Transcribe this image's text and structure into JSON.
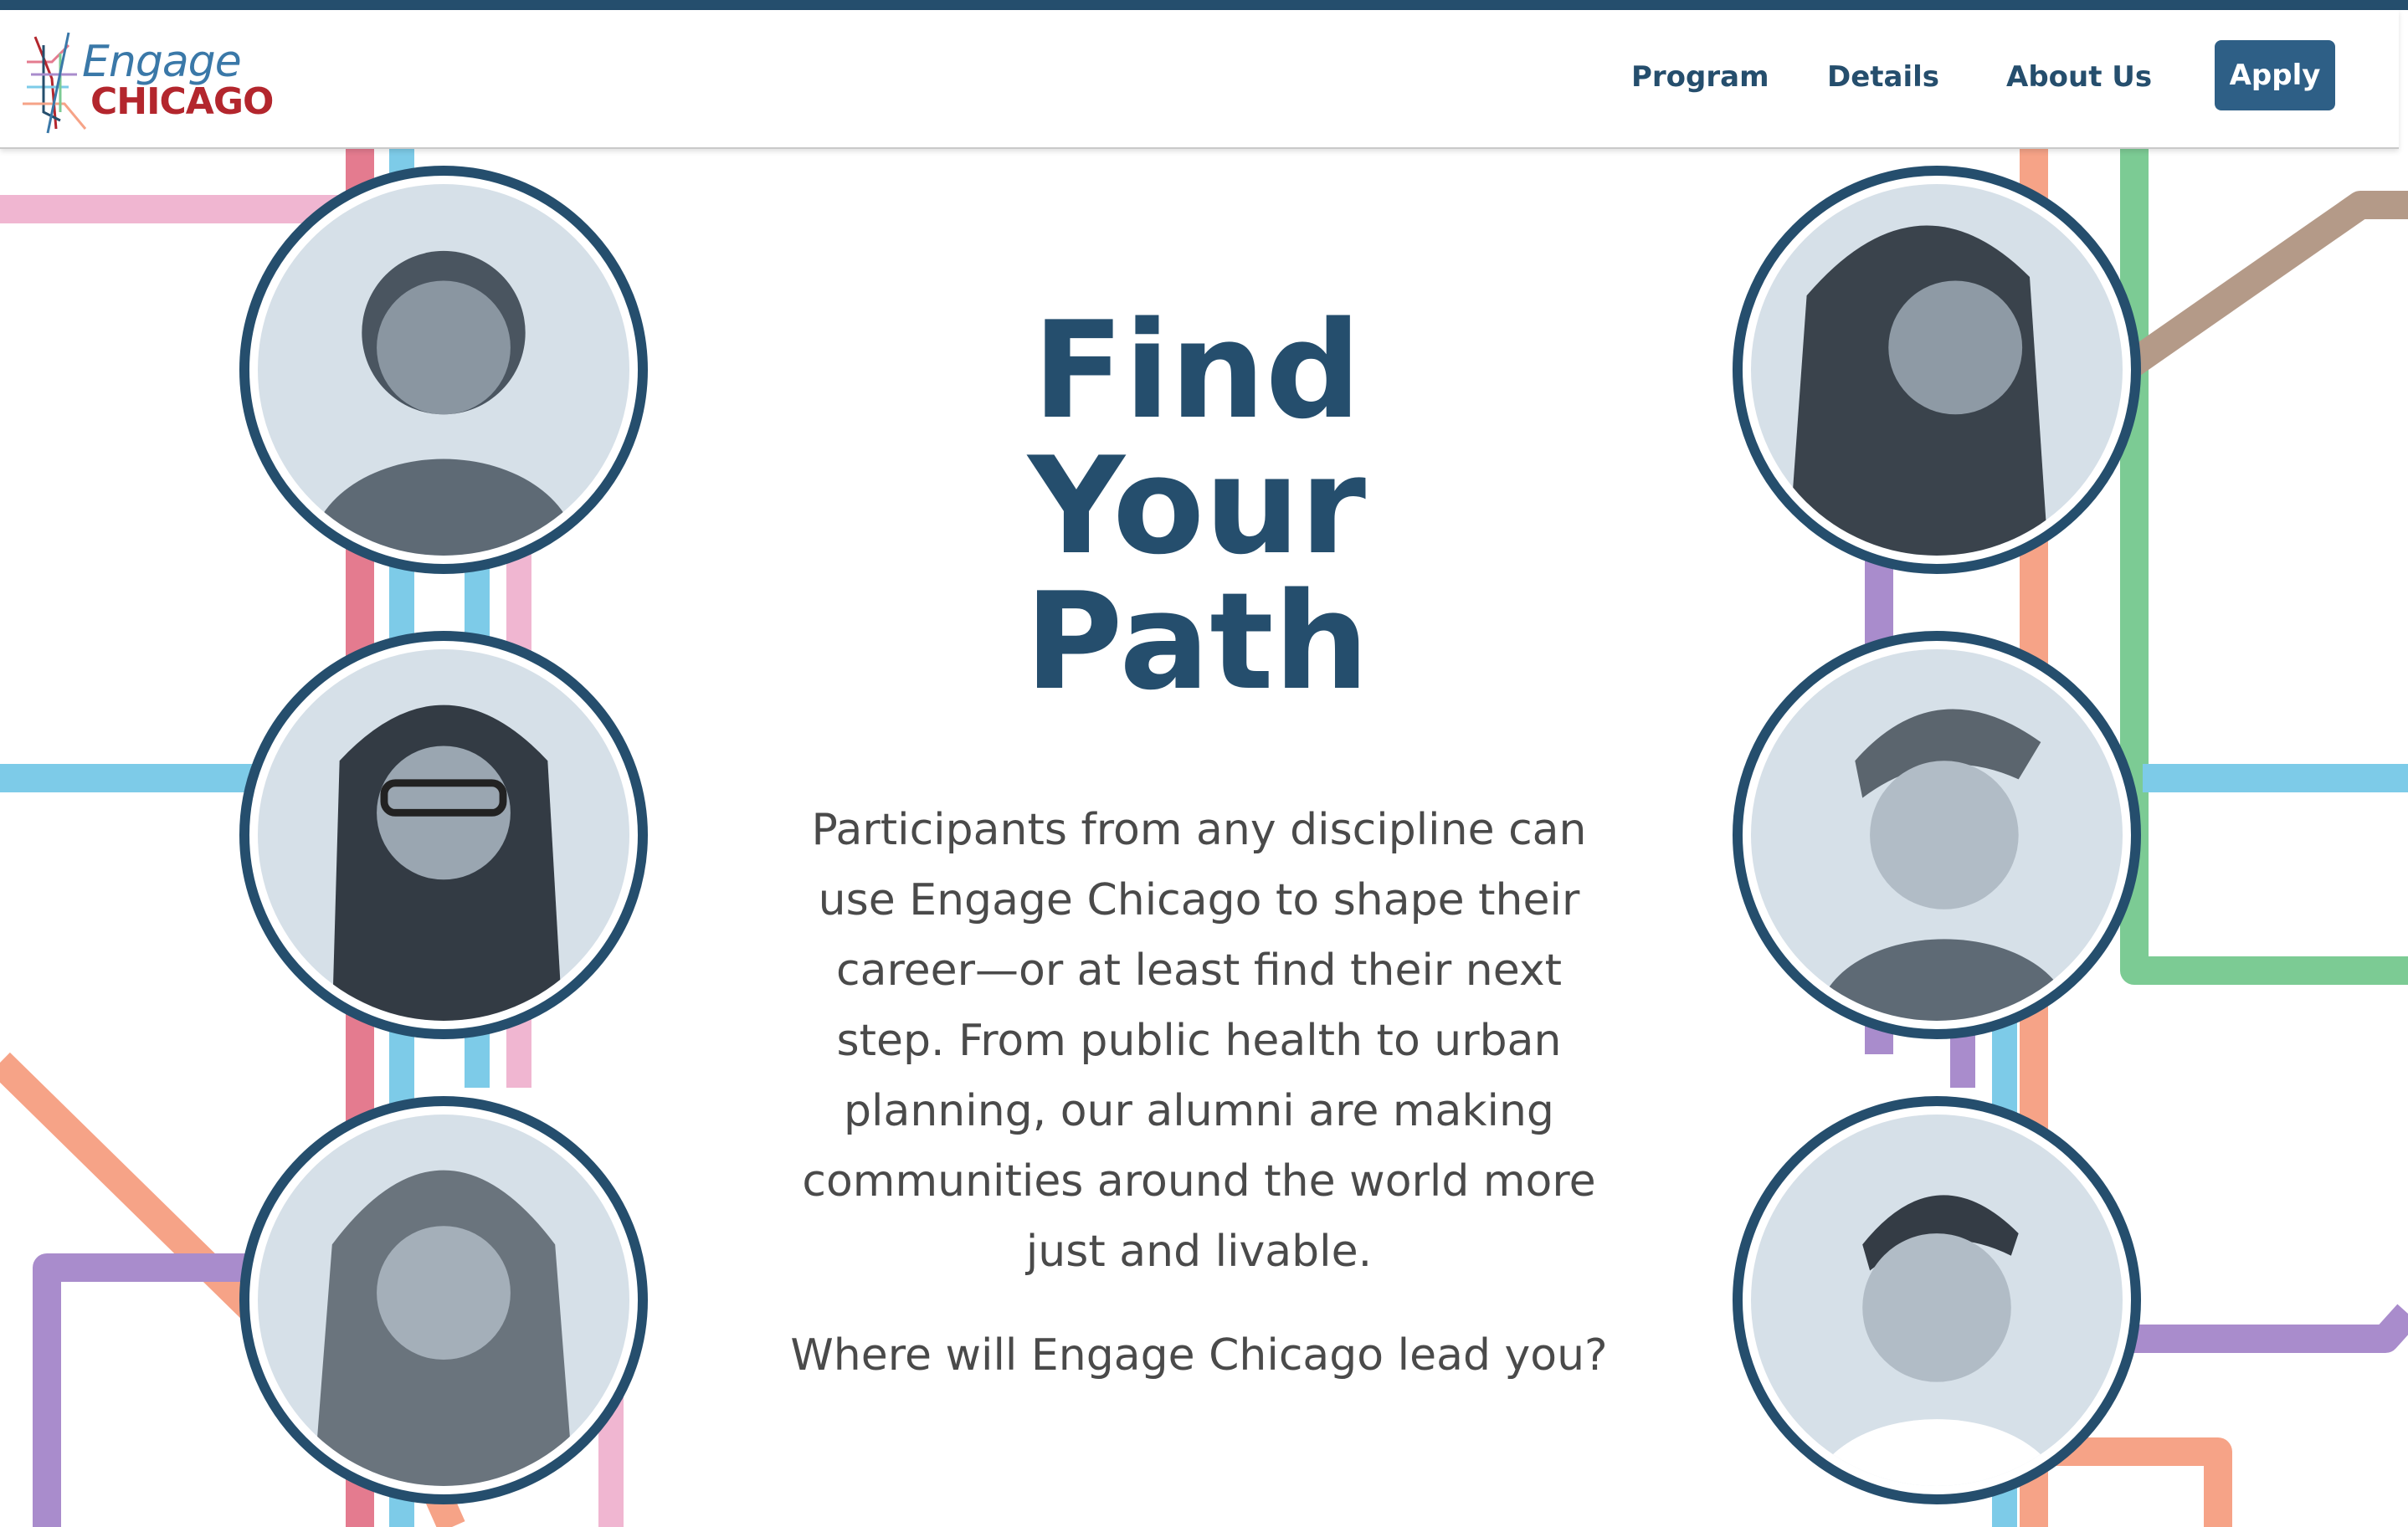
{
  "brand": {
    "line1": "Engage",
    "line2": "CHICAGO"
  },
  "nav": {
    "program": "Program",
    "details": "Details",
    "about": "About Us",
    "apply": "Apply"
  },
  "hero": {
    "title_line1": "Find",
    "title_line2": "Your",
    "title_line3": "Path",
    "body": "Participants from any discipline can use Engage Chicago to shape their career—or at least find their next step. From public health to urban planning, our alumni are making communities around the world more just and livable.",
    "question": "Where will Engage Chicago lead you?"
  },
  "colors": {
    "navy": "#254e6d",
    "button": "#2e5f86",
    "logo_blue": "#3a78a8",
    "logo_red": "#b3262d",
    "line_pink": "#f0b6d1",
    "line_red": "#e47b8f",
    "line_blue": "#7dcbe8",
    "line_green": "#7ccb94",
    "line_purple": "#a98ccc",
    "line_orange": "#f6a387",
    "line_brown": "#b49a88"
  },
  "icons": {
    "logo_mark": "chicago-transit-map-icon"
  }
}
